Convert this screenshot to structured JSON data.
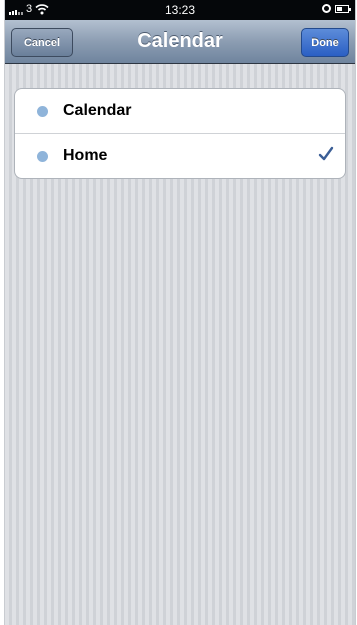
{
  "status_bar": {
    "carrier": "3",
    "time": "13:23"
  },
  "nav_bar": {
    "title": "Calendar",
    "cancel_label": "Cancel",
    "done_label": "Done"
  },
  "calendar_list": {
    "items": [
      {
        "label": "Calendar",
        "dot_color": "#8fb4da",
        "selected": false
      },
      {
        "label": "Home",
        "dot_color": "#8fb4da",
        "selected": true
      }
    ]
  },
  "colors": {
    "nav_bar": "#8c9db2",
    "done_button": "#2a5fc4",
    "checkmark": "#3b5e96",
    "background": "#d6d9de"
  }
}
